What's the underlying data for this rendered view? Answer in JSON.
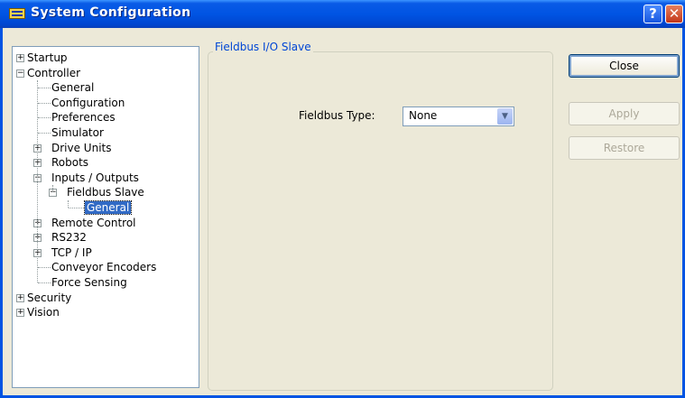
{
  "window": {
    "title": "System Configuration",
    "help_label": "?",
    "close_label": "✕"
  },
  "tree": [
    {
      "label": "Startup",
      "level": 0,
      "toggle": "+"
    },
    {
      "label": "Controller",
      "level": 0,
      "toggle": "−"
    },
    {
      "label": "General",
      "level": 1,
      "toggle": ""
    },
    {
      "label": "Configuration",
      "level": 1,
      "toggle": ""
    },
    {
      "label": "Preferences",
      "level": 1,
      "toggle": ""
    },
    {
      "label": "Simulator",
      "level": 1,
      "toggle": ""
    },
    {
      "label": "Drive Units",
      "level": 1,
      "toggle": "+"
    },
    {
      "label": "Robots",
      "level": 1,
      "toggle": "+"
    },
    {
      "label": "Inputs / Outputs",
      "level": 1,
      "toggle": "−"
    },
    {
      "label": "Fieldbus Slave",
      "level": 2,
      "toggle": "−"
    },
    {
      "label": "General",
      "level": 3,
      "toggle": "",
      "selected": true
    },
    {
      "label": "Remote Control",
      "level": 1,
      "toggle": "+"
    },
    {
      "label": "RS232",
      "level": 1,
      "toggle": "+"
    },
    {
      "label": "TCP / IP",
      "level": 1,
      "toggle": "+"
    },
    {
      "label": "Conveyor Encoders",
      "level": 1,
      "toggle": ""
    },
    {
      "label": "Force Sensing",
      "level": 1,
      "toggle": ""
    },
    {
      "label": "Security",
      "level": 0,
      "toggle": "+"
    },
    {
      "label": "Vision",
      "level": 0,
      "toggle": "+"
    }
  ],
  "group": {
    "title": "Fieldbus I/O Slave"
  },
  "fieldbus": {
    "label": "Fieldbus Type:",
    "value": "None"
  },
  "buttons": {
    "close": "Close",
    "apply": "Apply",
    "restore": "Restore"
  }
}
